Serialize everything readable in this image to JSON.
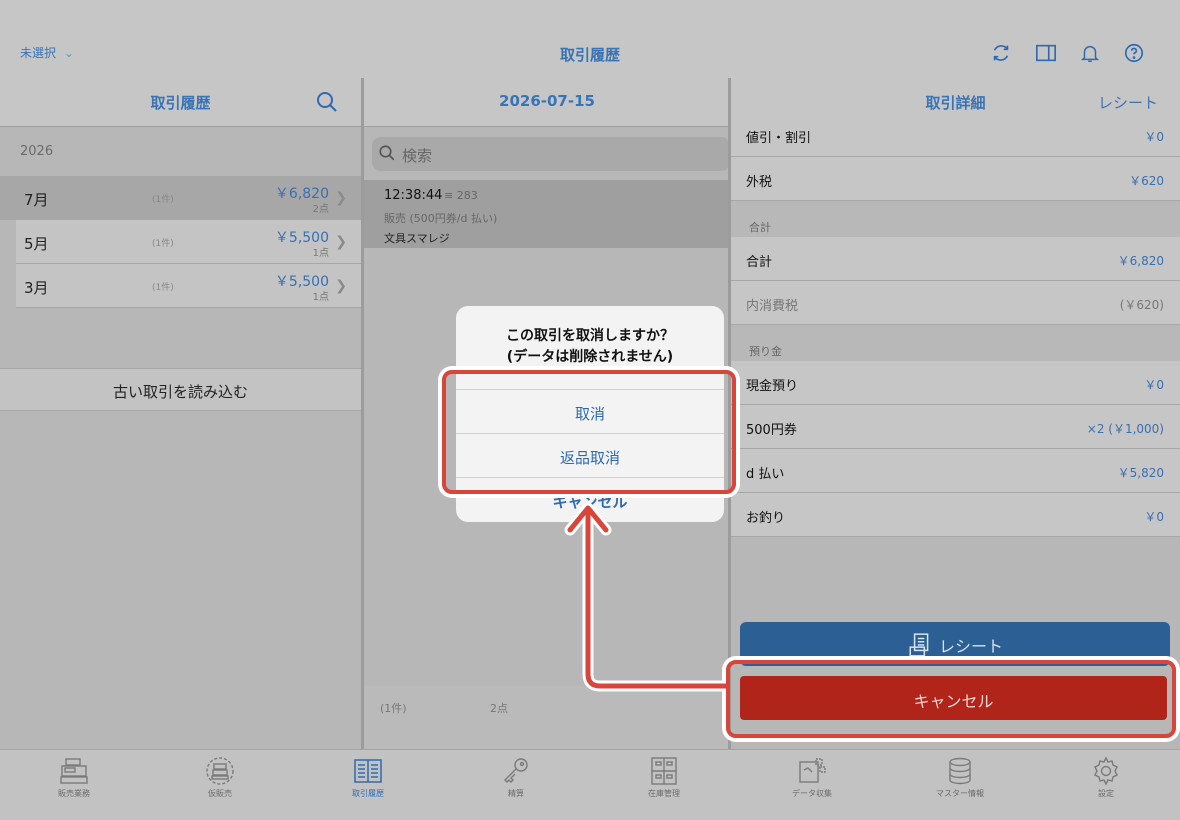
{
  "topbar": {
    "unselected_label": "未選択",
    "title": "取引履歴"
  },
  "left": {
    "header": "取引履歴",
    "year": "2026",
    "months": [
      {
        "label": "7月",
        "count": "(1件)",
        "amount": "￥6,820",
        "points": "2点"
      },
      {
        "label": "5月",
        "count": "(1件)",
        "amount": "￥5,500",
        "points": "1点"
      },
      {
        "label": "3月",
        "count": "(1件)",
        "amount": "￥5,500",
        "points": "1点"
      }
    ],
    "load_old": "古い取引を読み込む"
  },
  "middle": {
    "header": "2026-07-15",
    "search_placeholder": "検索",
    "transaction": {
      "time": "12:38:44",
      "number": "≡ 283",
      "kind": "販売 (500円券/d 払い)",
      "shop": "文具スマレジ"
    },
    "footer_count": "(1件)",
    "footer_points": "2点"
  },
  "right": {
    "header": "取引詳細",
    "receipt_link": "レシート",
    "rows1": [
      {
        "label": "値引・割引",
        "value": "￥0"
      },
      {
        "label": "外税",
        "value": "￥620"
      }
    ],
    "section_total": "合計",
    "rows2": [
      {
        "label": "合計",
        "value": "￥6,820"
      },
      {
        "label": "内消費税",
        "value": "(￥620)"
      }
    ],
    "section_deposit": "預り金",
    "rows3": [
      {
        "label": "現金預り",
        "value": "￥0"
      },
      {
        "label": "500円券",
        "value": "×2 (￥1,000)"
      },
      {
        "label": "d 払い",
        "value": "￥5,820"
      },
      {
        "label": "お釣り",
        "value": "￥0"
      }
    ],
    "receipt_button": "レシート",
    "cancel_button": "キャンセル"
  },
  "modal": {
    "line1": "この取引を取消しますか？",
    "line2": "(データは削除されません)",
    "option_cancel": "取消",
    "option_return_cancel": "返品取消",
    "option_dismiss": "キャンセル"
  },
  "tabs": [
    {
      "label": "販売業務",
      "icon": "register-icon"
    },
    {
      "label": "仮販売",
      "icon": "temp-sale-icon"
    },
    {
      "label": "取引履歴",
      "icon": "history-book-icon",
      "active": true
    },
    {
      "label": "精算",
      "icon": "key-icon"
    },
    {
      "label": "在庫管理",
      "icon": "cabinet-icon"
    },
    {
      "label": "データ収集",
      "icon": "data-collect-icon"
    },
    {
      "label": "マスター情報",
      "icon": "database-icon"
    },
    {
      "label": "設定",
      "icon": "gear-icon"
    }
  ],
  "colors": {
    "accent_blue": "#2f6ab0",
    "cancel_red": "#b02419",
    "highlight_red": "#d8453b"
  }
}
